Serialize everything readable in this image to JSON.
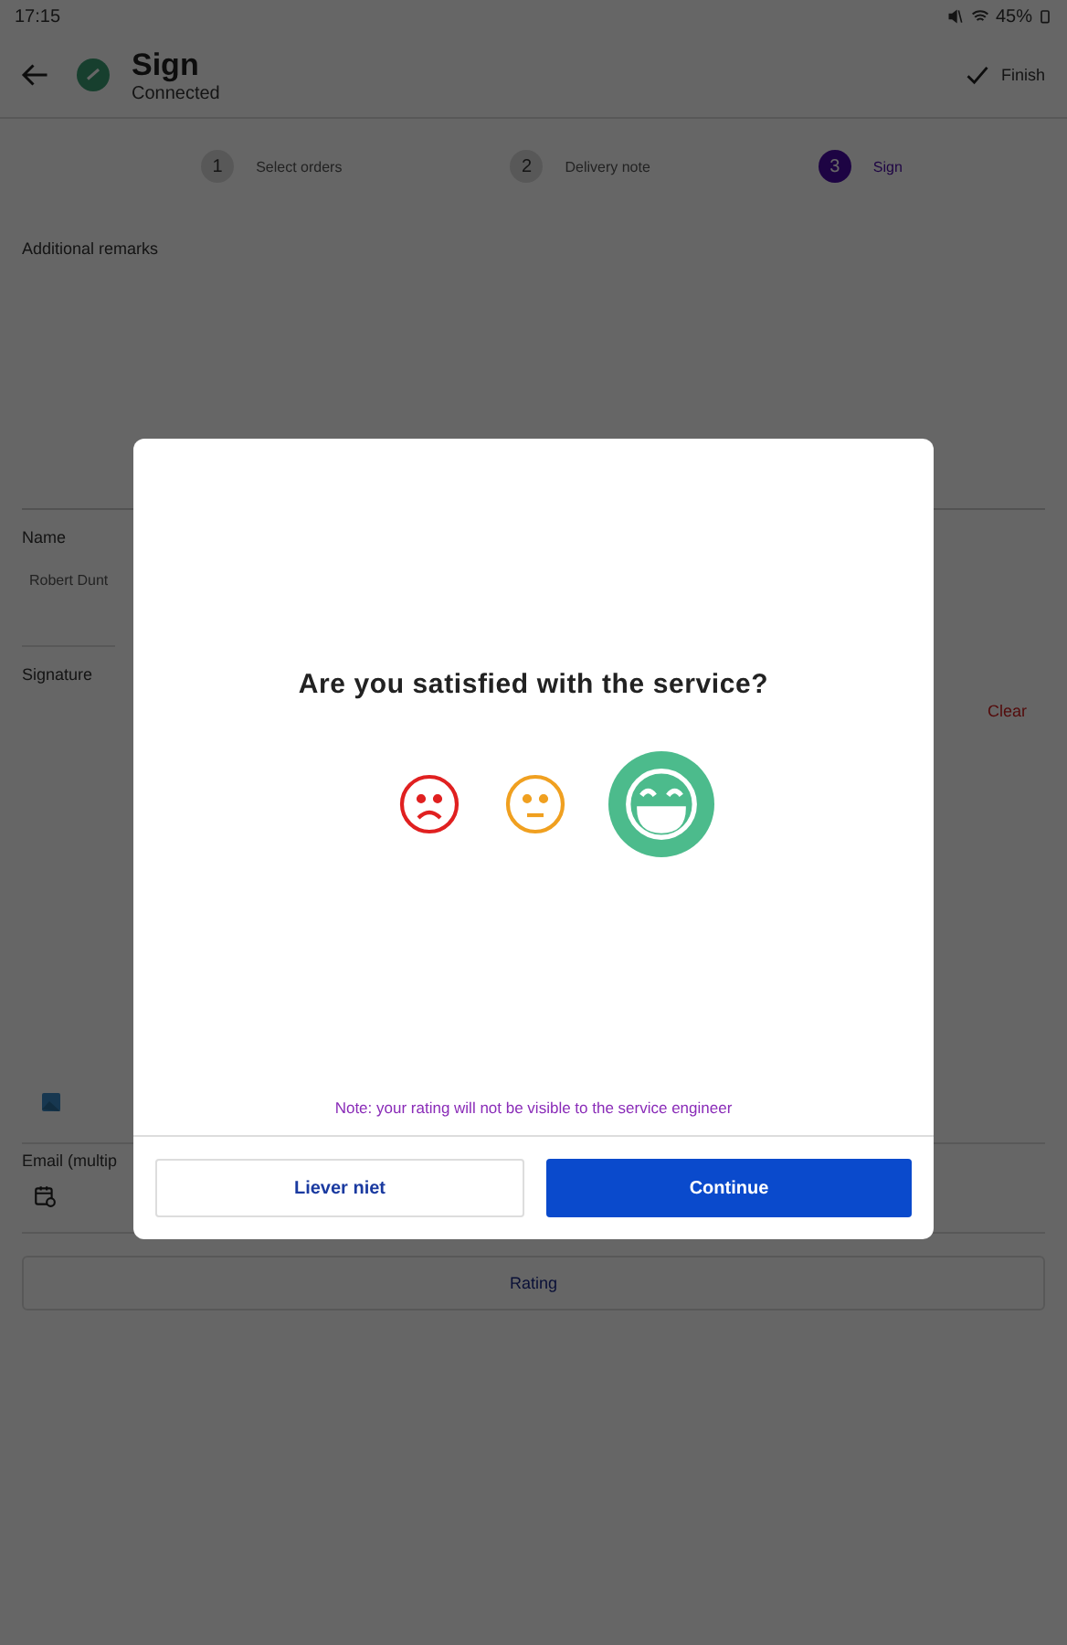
{
  "status_bar": {
    "time": "17:15",
    "battery": "45%"
  },
  "header": {
    "title": "Sign",
    "subtitle": "Connected",
    "action": "Finish"
  },
  "steps": [
    {
      "number": "1",
      "label": "Select orders",
      "selected": false
    },
    {
      "number": "2",
      "label": "Delivery note",
      "selected": false
    },
    {
      "number": "3",
      "label": "Sign",
      "selected": true
    }
  ],
  "form": {
    "remarks_label": "Additional remarks",
    "name_label": "Name",
    "name_value": "Robert Dunt",
    "signature_label": "Signature",
    "clear": "Clear",
    "email_label": "Email (multip",
    "rating_button": "Rating"
  },
  "dialog": {
    "question": "Are you satisfied with the service?",
    "faces": [
      {
        "kind": "sad",
        "color": "#e02020",
        "selected": false
      },
      {
        "kind": "neutral",
        "color": "#f0a020",
        "selected": false
      },
      {
        "kind": "happy",
        "color": "#4cbb8c",
        "selected": true
      }
    ],
    "note": "Note: your rating will not be visible to the service engineer",
    "buttons": [
      {
        "label": "Liever niet",
        "kind": "secondary"
      },
      {
        "label": "Continue",
        "kind": "primary"
      }
    ]
  }
}
